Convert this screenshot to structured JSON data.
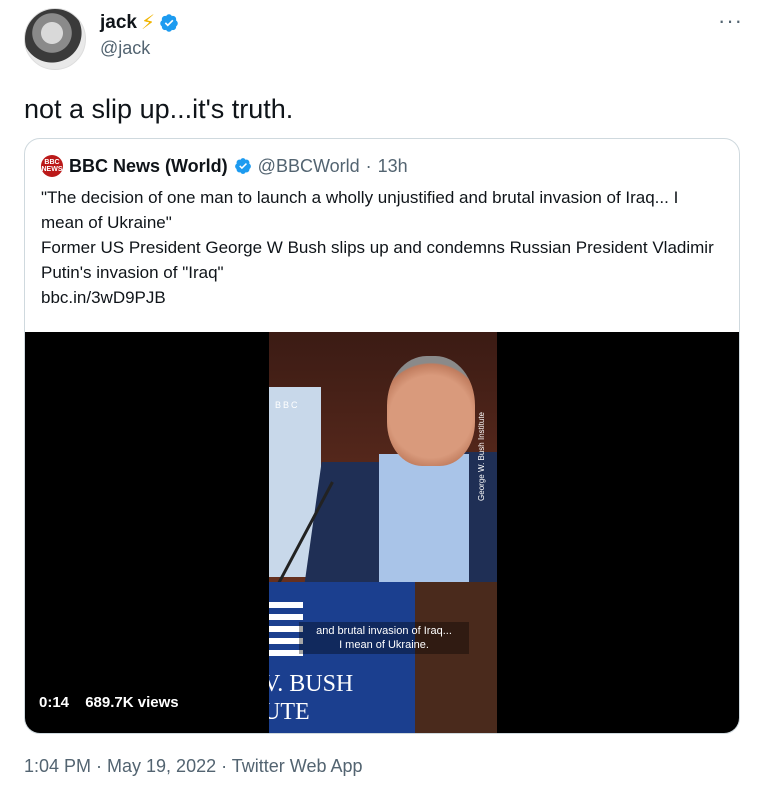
{
  "author": {
    "display_name": "jack",
    "emoji": "⚡",
    "handle": "@jack",
    "verified_icon": "verified-badge"
  },
  "menu_icon": "more-dots-icon",
  "tweet": {
    "text": "not a slip up...it's truth."
  },
  "quoted": {
    "name": "BBC News (World)",
    "handle": "@BBCWorld",
    "time": "13h",
    "logo_text": "BBC NEWS",
    "lines": [
      "\"The decision of one man to launch a wholly unjustified and brutal invasion of Iraq... I mean of Ukraine\"",
      "Former US President George W Bush slips up and condemns Russian President Vladimir Putin's invasion of \"Iraq\"",
      "bbc.in/3wD9PJB"
    ]
  },
  "video": {
    "duration": "0:14",
    "views": "689.7K views",
    "caption_line1": "and brutal invasion of Iraq...",
    "caption_line2": "I mean of Ukraine.",
    "podium_line1": "V. BUSH",
    "podium_line2": "UTE",
    "side_caption": "George W. Bush Institute",
    "bbc_badge": "BBC"
  },
  "footer": {
    "text": "1:04 PM · May 19, 2022 · Twitter Web App"
  },
  "colors": {
    "verified": "#1d9bf0",
    "bolt": "#f0b400",
    "bbc_red": "#bb1919",
    "muted": "#536471"
  }
}
